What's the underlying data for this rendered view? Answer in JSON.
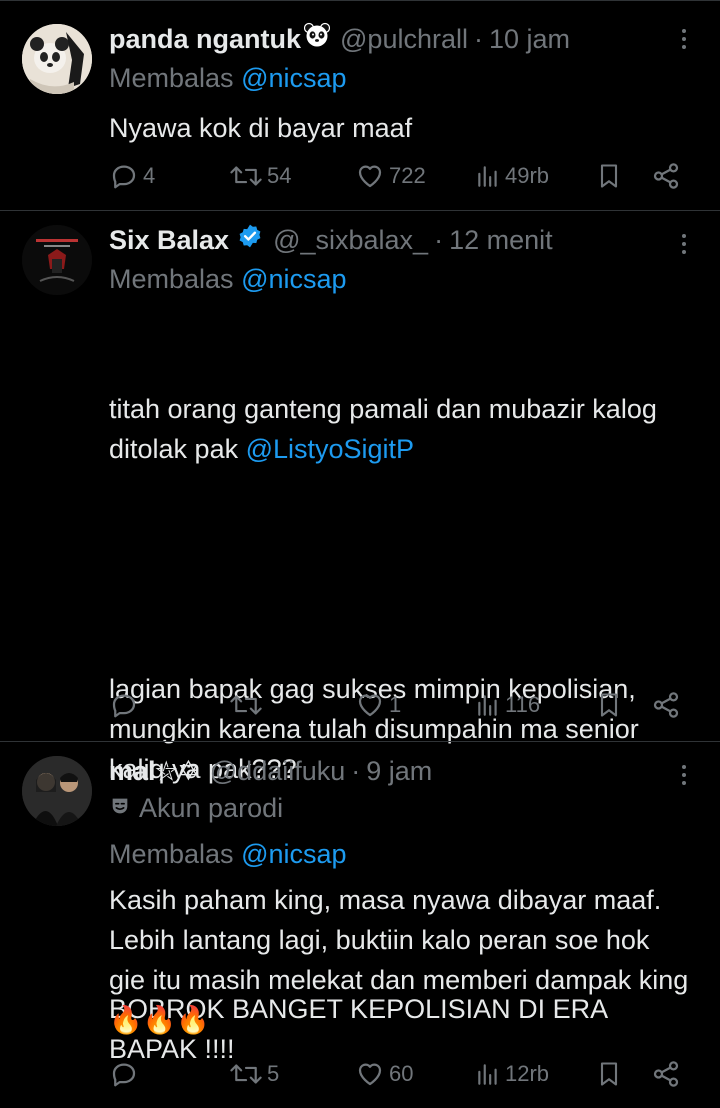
{
  "tweets": [
    {
      "name": "panda ngantuk",
      "name_emoji": "panda-face-icon",
      "handle": "@pulchrall",
      "separator": "·",
      "time": "10 jam",
      "replying_prefix": "Membalas",
      "replying_to": "@nicsap",
      "text": "Nyawa kok di bayar maaf",
      "stats": {
        "replies": "4",
        "retweets": "54",
        "likes": "722",
        "views": "49rb"
      }
    },
    {
      "name": "Six Balax",
      "verified": true,
      "handle": "@_sixbalax_",
      "separator": "·",
      "time": "12 menit",
      "replying_prefix": "Membalas",
      "replying_to": "@nicsap",
      "text_line1": "titah orang ganteng pamali dan mubazir kalog ditolak pak ",
      "text_mention": "@ListyoSigitP",
      "text_p2": "lagian bapak gag sukses mimpin kepolisian, mungkin karena tulah disumpahin ma senior kaliq ya pak???",
      "text_p3": "BOBROK BANGET KEPOLISIAN DI ERA BAPAK !!!!",
      "stats": {
        "replies": "",
        "retweets": "",
        "likes": "1",
        "views": "116"
      }
    },
    {
      "name": "mal",
      "name_suffix": "⛦✡",
      "handle": "@ddaiifuku",
      "separator": "·",
      "time": "9 jam",
      "parody_label": "Akun parodi",
      "replying_prefix": "Membalas",
      "replying_to": "@nicsap",
      "text": "Kasih paham king, masa nyawa dibayar maaf. Lebih lantang lagi, buktiin kalo peran soe hok gie itu masih melekat dan memberi dampak king 🔥🔥🔥",
      "stats": {
        "replies": "",
        "retweets": "5",
        "likes": "60",
        "views": "12rb"
      }
    }
  ],
  "colors": {
    "background": "#000000",
    "text": "#e7e9ea",
    "muted": "#71767b",
    "link": "#1d9bf0",
    "divider": "#2f3336",
    "verified": "#1d9bf0"
  }
}
